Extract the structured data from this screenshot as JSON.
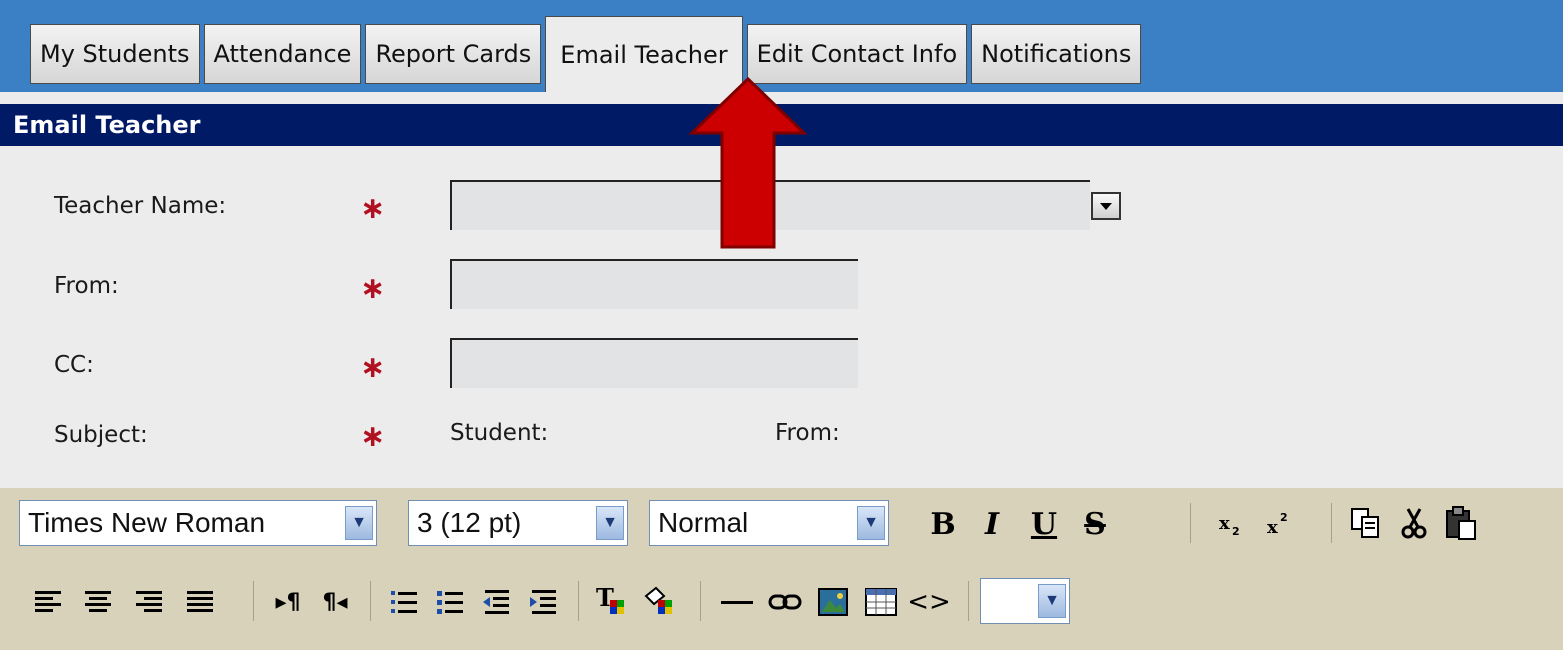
{
  "tabs": [
    {
      "label": "My Students"
    },
    {
      "label": "Attendance"
    },
    {
      "label": "Report Cards"
    },
    {
      "label": "Email Teacher"
    },
    {
      "label": "Edit Contact Info"
    },
    {
      "label": "Notifications"
    }
  ],
  "section_title": "Email Teacher",
  "form": {
    "teacher_label": "Teacher Name:",
    "from_label": "From:",
    "cc_label": "CC:",
    "subject_label": "Subject:",
    "required_mark": "∗",
    "subject_student": "Student:",
    "subject_from": "From:"
  },
  "editor": {
    "font_select": "Times New Roman",
    "size_select": "3 (12 pt)",
    "format_select": "Normal",
    "bold": "B",
    "italic": "I",
    "underline": "U",
    "strike": "S",
    "dropdown_arrow": "⌄"
  },
  "icons": [
    "chevron-down-icon",
    "copy-icon",
    "cut-icon",
    "paste-icon",
    "align-left-icon",
    "align-center-icon",
    "align-right-icon",
    "justify-icon",
    "ltr-icon",
    "rtl-icon",
    "ordered-list-icon",
    "unordered-list-icon",
    "outdent-icon",
    "indent-icon",
    "text-color-icon",
    "highlight-color-icon",
    "horizontal-rule-icon",
    "link-icon",
    "image-icon",
    "table-icon",
    "code-icon"
  ]
}
